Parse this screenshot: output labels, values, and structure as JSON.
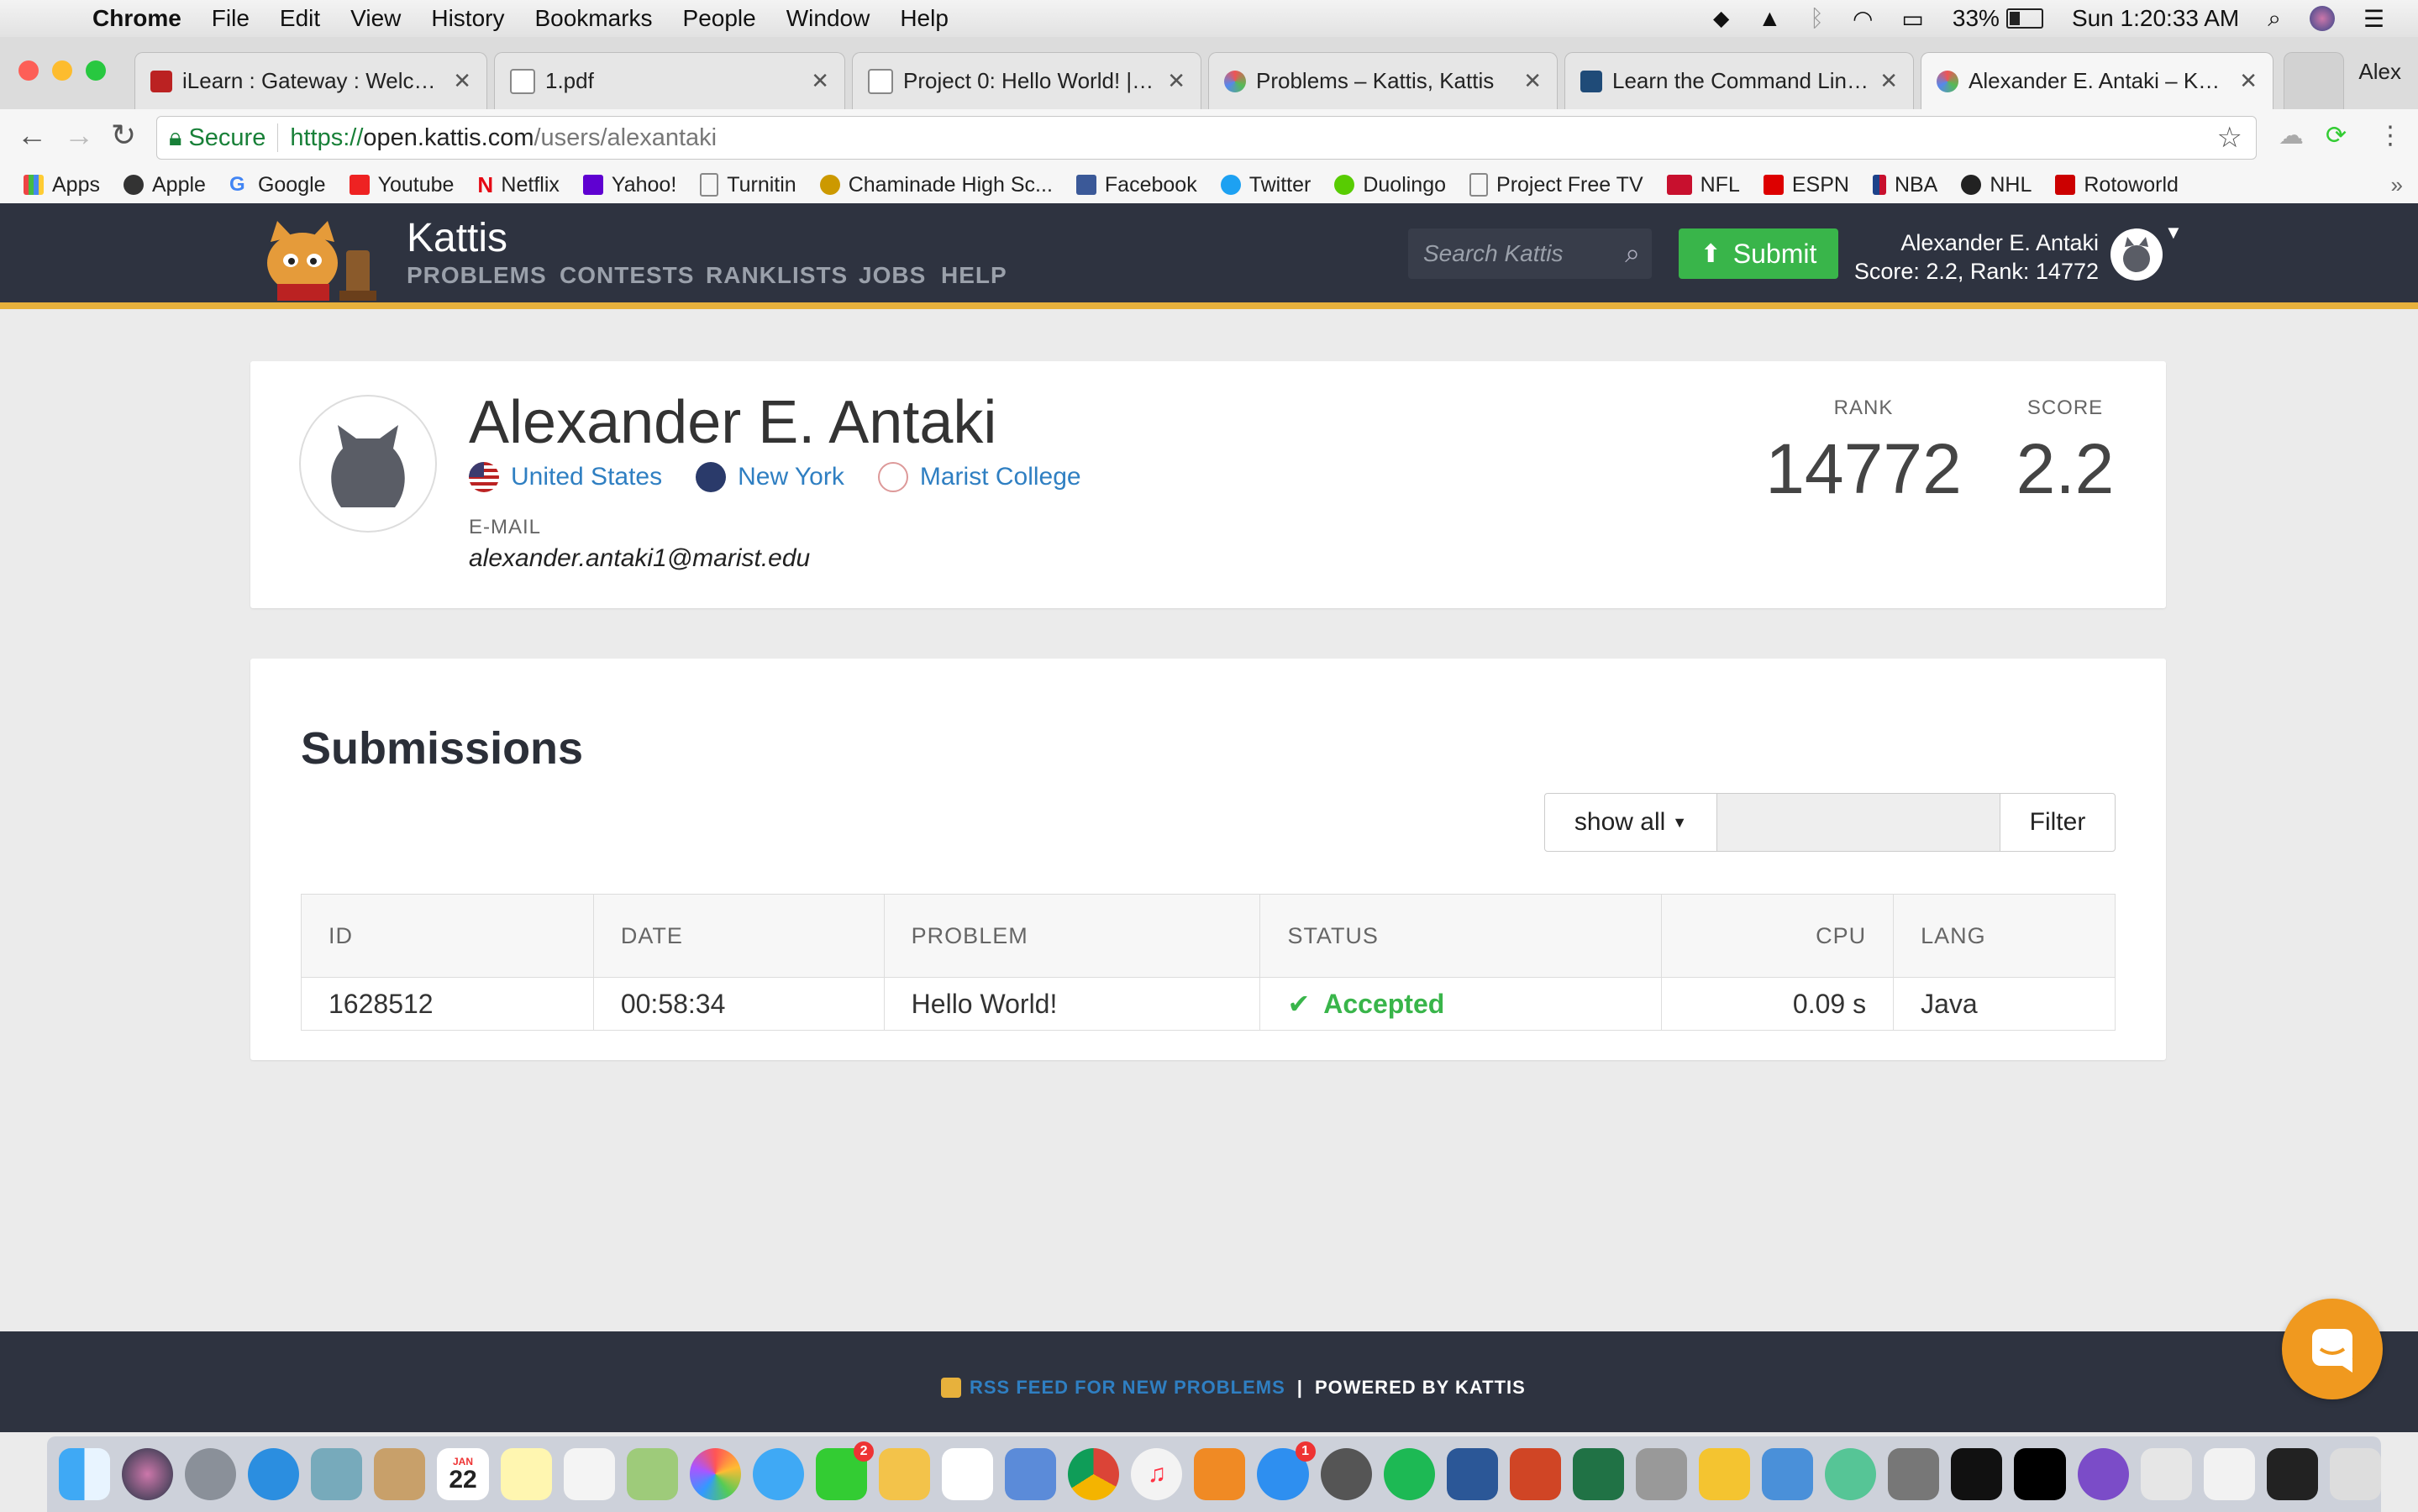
{
  "menubar": {
    "items": [
      "Chrome",
      "File",
      "Edit",
      "View",
      "History",
      "Bookmarks",
      "People",
      "Window",
      "Help"
    ],
    "battery": "33%",
    "clock": "Sun 1:20:33 AM"
  },
  "profile_name": "Alex",
  "tabs": [
    {
      "label": "iLearn : Gateway : Welcome"
    },
    {
      "label": "1.pdf"
    },
    {
      "label": "Project 0: Hello World! | CM"
    },
    {
      "label": "Problems – Kattis, Kattis"
    },
    {
      "label": "Learn the Command Line | C"
    },
    {
      "label": "Alexander E. Antaki – Kattis,"
    }
  ],
  "address": {
    "secure_label": "Secure",
    "url_scheme": "https://",
    "url_host": "open.kattis.com",
    "url_path": "/users/alexantaki"
  },
  "bookmarks": [
    "Apps",
    "Apple",
    "Google",
    "Youtube",
    "Netflix",
    "Yahoo!",
    "Turnitin",
    "Chaminade High Sc...",
    "Facebook",
    "Twitter",
    "Duolingo",
    "Project Free TV",
    "NFL",
    "ESPN",
    "NBA",
    "NHL",
    "Rotoworld"
  ],
  "kattis": {
    "brand": "Kattis",
    "nav": [
      "PROBLEMS",
      "CONTESTS",
      "RANKLISTS",
      "JOBS",
      "HELP"
    ],
    "search_placeholder": "Search Kattis",
    "submit_label": "Submit",
    "user_name": "Alexander E. Antaki",
    "user_stats": "Score: 2.2, Rank: 14772"
  },
  "profile": {
    "name": "Alexander E. Antaki",
    "country": "United States",
    "state": "New York",
    "school": "Marist College",
    "email_label": "E-MAIL",
    "email": "alexander.antaki1@marist.edu",
    "rank_label": "RANK",
    "rank": "14772",
    "score_label": "SCORE",
    "score": "2.2"
  },
  "submissions": {
    "title": "Submissions",
    "filter_select": "show all",
    "filter_button": "Filter",
    "columns": [
      "ID",
      "DATE",
      "PROBLEM",
      "STATUS",
      "CPU",
      "LANG"
    ],
    "rows": [
      {
        "id": "1628512",
        "date": "00:58:34",
        "problem": "Hello World!",
        "status": "Accepted",
        "cpu": "0.09 s",
        "lang": "Java"
      }
    ]
  },
  "footer": {
    "rss": "RSS FEED FOR NEW PROBLEMS",
    "powered": "POWERED BY KATTIS"
  },
  "dock": {
    "calendar_month": "JAN",
    "calendar_day": "22",
    "badge_messages": "2",
    "badge_appstore": "1"
  }
}
